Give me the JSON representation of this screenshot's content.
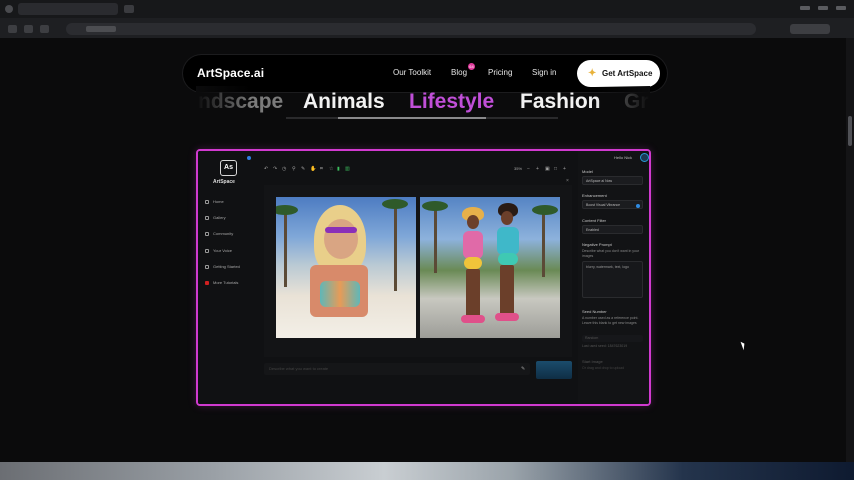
{
  "site": {
    "logo": "ArtSpace.ai",
    "nav_links": [
      "Our Toolkit",
      "Blog",
      "Pricing",
      "Sign in"
    ],
    "blog_badge": "64",
    "cta_label": "Get ArtSpace",
    "cta_icon": "sparkle-icon"
  },
  "categories": {
    "items": [
      "ndscape",
      "Animals",
      "Lifestyle",
      "Fashion",
      "Gr"
    ],
    "active": "Lifestyle",
    "accent_color": "#c04fd8"
  },
  "app": {
    "logo_mark": "As",
    "logo_text": "ArtSpace",
    "sidebar": [
      "Home",
      "Gallery",
      "Community",
      "Your Voice",
      "Getting Started",
      "More Tutorials"
    ],
    "zoom": "35%",
    "prompt_placeholder": "Describe what you want to create",
    "right_panel": {
      "greeting": "Hello Nick",
      "model_label": "Model",
      "model_value": "ArtSpace ai Now",
      "enhancement_label": "Enhancement",
      "enhancement_value": "Boost Visual Vibrance",
      "content_filter_label": "Content Filter",
      "content_filter_value": "Enabled",
      "negative_prompt_label": "Negative Prompt",
      "negative_prompt_desc": "Describe what you don't want in your images",
      "negative_prompt_value": "blurry, watermark, text, logo",
      "seed_label": "Seed Number",
      "seed_desc": "A number used as a reference point. Leave this blank to get new images",
      "seed_value": "Random",
      "seed_hint": "Last used seed: 1847623019",
      "start_image_label": "Start Image",
      "start_image_hint": "Or drag and drop to upload"
    }
  },
  "colors": {
    "frame_border": "#d13ad0",
    "cta_bg": "#ffffff",
    "page_bg": "#0b0b0c"
  }
}
